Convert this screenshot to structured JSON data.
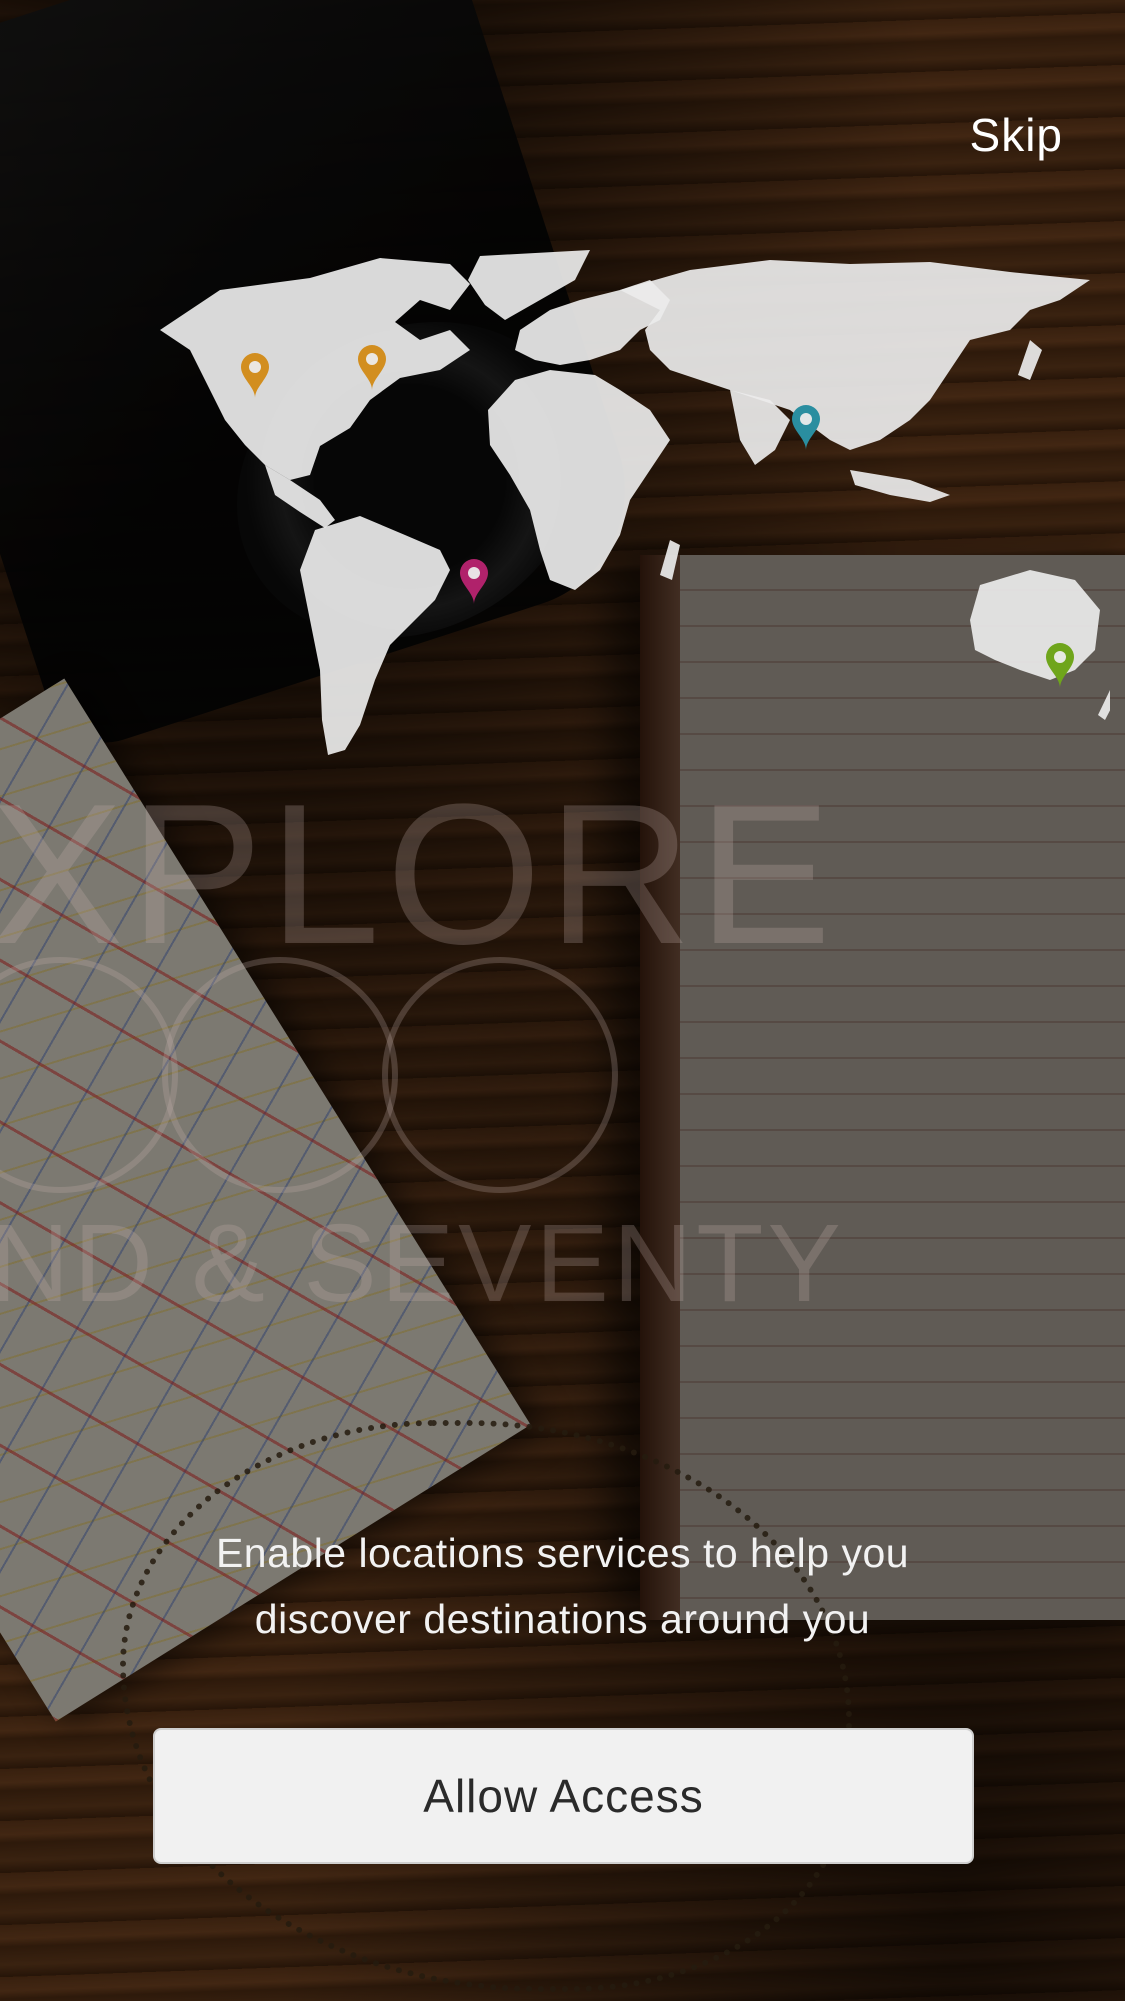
{
  "header": {
    "skip_label": "Skip"
  },
  "watermark": {
    "word_top": "XPLORE",
    "word_bottom": "ND & SEVENTY"
  },
  "map_pins": [
    {
      "name": "pin-west-north-america",
      "color": "#d28e1f"
    },
    {
      "name": "pin-central-north-america",
      "color": "#d28e1f"
    },
    {
      "name": "pin-south-america",
      "color": "#b0226b"
    },
    {
      "name": "pin-middle-east",
      "color": "#2a8ea0"
    },
    {
      "name": "pin-australia",
      "color": "#6fa51b"
    }
  ],
  "onboarding": {
    "message_line1": "Enable locations services to help you",
    "message_line2": "discover destinations around you",
    "allow_button_label": "Allow Access"
  }
}
